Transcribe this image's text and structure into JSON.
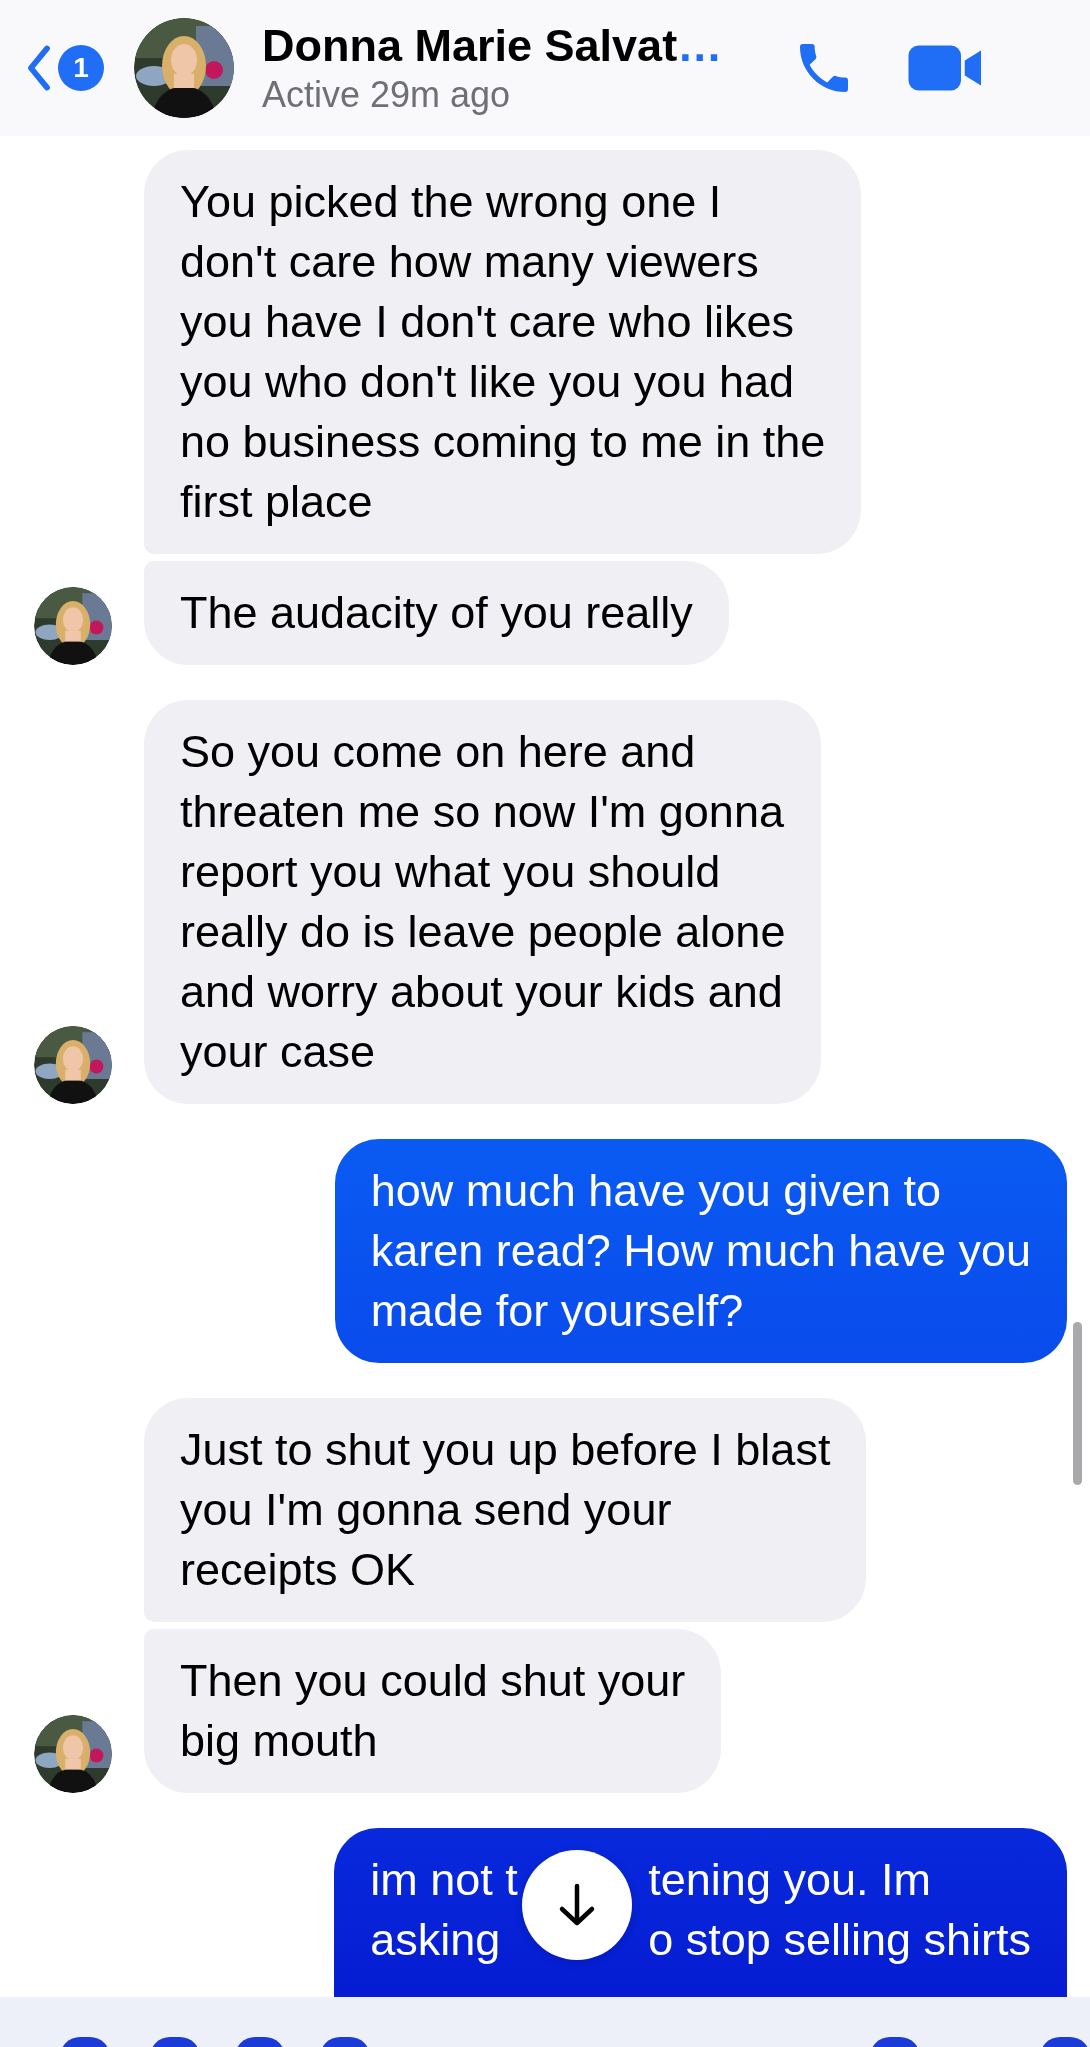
{
  "header": {
    "back_badge": "1",
    "contact_name": "Donna Marie Salvat",
    "name_ellipsis": "…",
    "status": "Active 29m ago"
  },
  "messages": [
    {
      "kind": "received",
      "text": "You picked the wrong one I\ndon't care how many viewers\nyou have I don't care who likes\nyou who don't like you you had\nno business coming to me in the\nfirst place",
      "show_avatar": false
    },
    {
      "kind": "received",
      "text": "The audacity of you really",
      "show_avatar": true
    },
    {
      "kind": "received",
      "text": "So you come on here and\nthreaten me so now I'm gonna\nreport you what you should\nreally do is leave people alone\nand worry about your kids and\nyour case",
      "show_avatar": true
    },
    {
      "kind": "sent",
      "text": "how much have you given to\nkaren read? How much have you\nmade for yourself?",
      "show_avatar": false
    },
    {
      "kind": "received",
      "text": "Just to shut you up before I blast\nyou I'm gonna send your\nreceipts OK",
      "show_avatar": false
    },
    {
      "kind": "received",
      "text": "Then you could shut your\nbig mouth",
      "show_avatar": true
    },
    {
      "kind": "sent",
      "lines": [
        [
          "im not t",
          "tening you. Im"
        ],
        [
          "asking",
          "o stop selling shirts"
        ]
      ],
      "show_avatar": false
    }
  ]
}
